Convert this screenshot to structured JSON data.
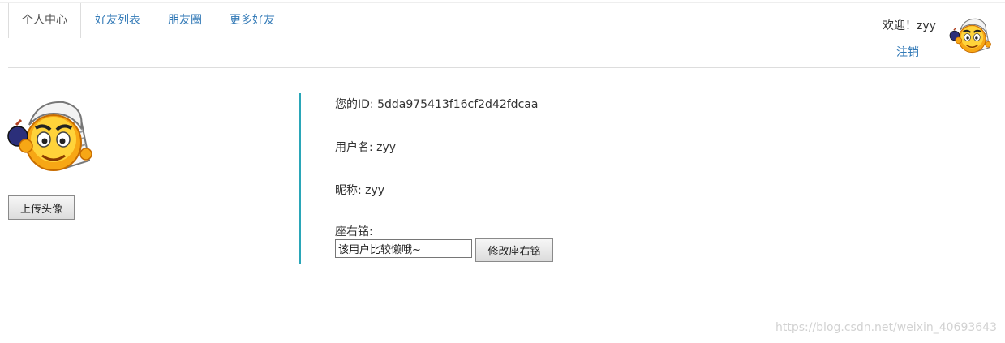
{
  "nav": {
    "tabs": [
      {
        "label": "个人中心",
        "active": true
      },
      {
        "label": "好友列表",
        "active": false
      },
      {
        "label": "朋友圈",
        "active": false
      },
      {
        "label": "更多好友",
        "active": false
      }
    ]
  },
  "header": {
    "welcome": "欢迎！zyy",
    "logout": "注销",
    "avatar_icon": "smiley-reporter-avatar"
  },
  "profile": {
    "upload_button": "上传头像",
    "id_line": "您的ID: 5dda975413f16cf2d42fdcaa",
    "username_line": "用户名: zyy",
    "nickname_line": "昵称: zyy",
    "motto_label": "座右铭:",
    "motto_value": "该用户比较懒哦~",
    "motto_button": "修改座右铭"
  },
  "watermark": "https://blog.csdn.net/weixin_40693643",
  "colors": {
    "link": "#337ab7",
    "divider_accent": "#2aa6b8"
  }
}
